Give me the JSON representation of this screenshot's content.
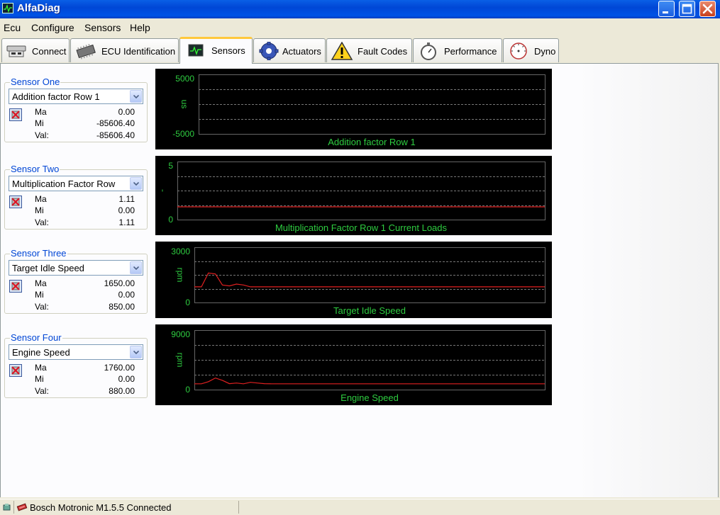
{
  "app": {
    "title": "AlfaDiag"
  },
  "menu": [
    "Ecu",
    "Configure",
    "Sensors",
    "Help"
  ],
  "tabs": [
    {
      "label": "Connect",
      "icon": "connect-icon"
    },
    {
      "label": "ECU Identification",
      "icon": "chip-icon"
    },
    {
      "label": "Sensors",
      "icon": "sensor-graph-icon",
      "active": true
    },
    {
      "label": "Actuators",
      "icon": "gear-icon"
    },
    {
      "label": "Fault Codes",
      "icon": "warning-icon"
    },
    {
      "label": "Performance",
      "icon": "stopwatch-icon"
    },
    {
      "label": "Dyno",
      "icon": "gauge-icon"
    }
  ],
  "sensors": [
    {
      "group_title": "Sensor One",
      "selected": "Addition factor Row 1",
      "ma_label": "Ma",
      "mi_label": "Mi",
      "val_label": "Val:",
      "ma": "0.00",
      "mi": "-85606.40",
      "val": "-85606.40"
    },
    {
      "group_title": "Sensor Two",
      "selected": "Multiplication Factor Row",
      "ma_label": "Ma",
      "mi_label": "Mi",
      "val_label": "Val:",
      "ma": "1.11",
      "mi": "0.00",
      "val": "1.11"
    },
    {
      "group_title": "Sensor Three",
      "selected": "Target Idle Speed",
      "ma_label": "Ma",
      "mi_label": "Mi",
      "val_label": "Val:",
      "ma": "1650.00",
      "mi": "0.00",
      "val": "850.00"
    },
    {
      "group_title": "Sensor Four",
      "selected": "Engine Speed",
      "ma_label": "Ma",
      "mi_label": "Mi",
      "val_label": "Val:",
      "ma": "1760.00",
      "mi": "0.00",
      "val": "880.00"
    }
  ],
  "chart_data": [
    {
      "type": "line",
      "title": "Addition factor Row 1",
      "ylabel": "us",
      "ylim": [
        -5000,
        5000
      ],
      "ytick_labels": [
        "5000",
        "-5000"
      ],
      "grid": true,
      "series": [
        {
          "values": [],
          "color": "#e02020"
        }
      ]
    },
    {
      "type": "line",
      "title": "Multiplication Factor Row 1 Current Loads",
      "ylabel": "-",
      "ylim": [
        0,
        5
      ],
      "ytick_labels": [
        "5",
        "0"
      ],
      "grid": true,
      "series": [
        {
          "values": [
            1.1,
            1.1,
            1.1,
            1.1,
            1.1,
            1.1,
            1.1,
            1.1,
            1.1,
            1.1,
            1.1
          ],
          "color": "#e02020"
        }
      ]
    },
    {
      "type": "line",
      "title": "Target Idle Speed",
      "ylabel": "rpm",
      "ylim": [
        0,
        3000
      ],
      "ytick_labels": [
        "3000",
        "0"
      ],
      "grid": true,
      "series": [
        {
          "values": [
            850,
            850,
            1600,
            1550,
            950,
            900,
            1000,
            950,
            850,
            850,
            850,
            850,
            850,
            850,
            850,
            850,
            850,
            850,
            850,
            850,
            850,
            850,
            850,
            850,
            850,
            850,
            850,
            850,
            850,
            850,
            850,
            850,
            850,
            850,
            850,
            850,
            850,
            850,
            850,
            850,
            850,
            850,
            850,
            850,
            850,
            850,
            850,
            850,
            850,
            850,
            850
          ],
          "color": "#e02020"
        }
      ]
    },
    {
      "type": "line",
      "title": "Engine Speed",
      "ylabel": "rpm",
      "ylim": [
        0,
        9000
      ],
      "ytick_labels": [
        "9000",
        "0"
      ],
      "grid": true,
      "series": [
        {
          "values": [
            880,
            880,
            1200,
            1760,
            1400,
            900,
            1000,
            880,
            1100,
            1000,
            900,
            880,
            880,
            880,
            880,
            880,
            880,
            880,
            880,
            880,
            880,
            880,
            880,
            880,
            880,
            880,
            880,
            880,
            880,
            880,
            880,
            880,
            880,
            880,
            880,
            880,
            880,
            880,
            880,
            880,
            880,
            880,
            880,
            880,
            880,
            880,
            880,
            880,
            880,
            880,
            880
          ],
          "color": "#e02020"
        }
      ]
    }
  ],
  "colors": {
    "chart_bg": "#000000",
    "chart_text": "#2ecc40",
    "series": "#e02020",
    "group_title": "#0046d5",
    "active_tab_highlight": "#ffc83c"
  },
  "status": {
    "text": "Bosch Motronic M1.5.5 Connected"
  }
}
